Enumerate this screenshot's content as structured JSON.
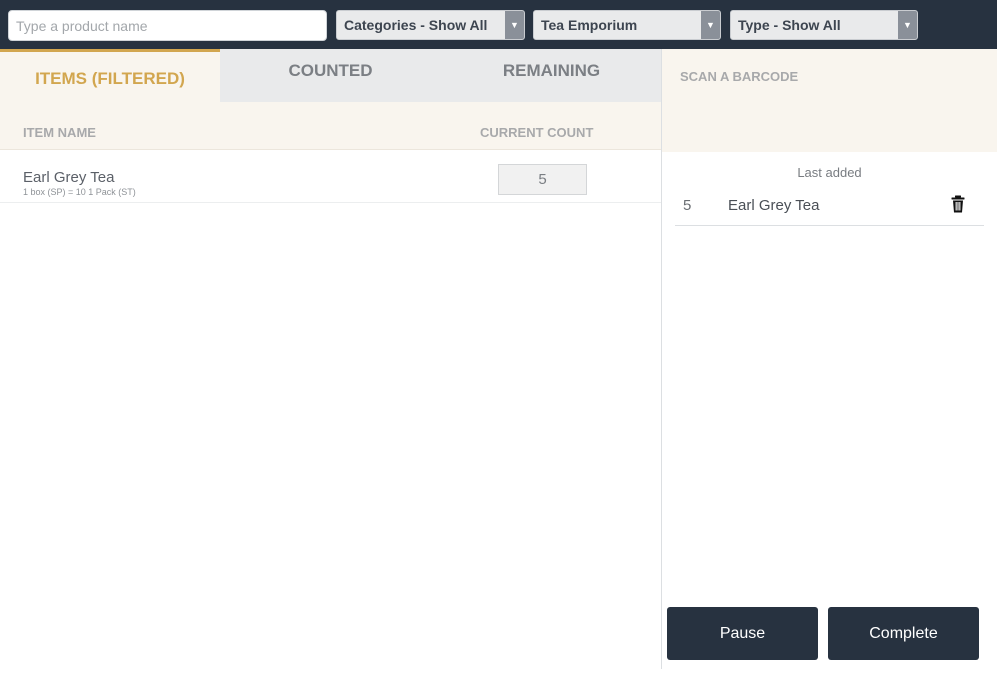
{
  "toolbar": {
    "search_placeholder": "Type a product name",
    "category_select": "Categories - Show All",
    "store_select": "Tea Emporium",
    "type_select": "Type - Show All"
  },
  "tabs": [
    {
      "label": "ITEMS (FILTERED)",
      "active": true
    },
    {
      "label": "COUNTED",
      "active": false
    },
    {
      "label": "REMAINING",
      "active": false
    }
  ],
  "table": {
    "headers": {
      "name": "ITEM NAME",
      "count": "CURRENT COUNT"
    },
    "rows": [
      {
        "name": "Earl Grey Tea",
        "detail": "1 box (SP) = 10 1 Pack (ST)",
        "count": "5"
      }
    ]
  },
  "scan_panel": {
    "title": "SCAN A BARCODE",
    "last_added_label": "Last added",
    "entries": [
      {
        "qty": "5",
        "name": "Earl Grey Tea",
        "icon": "trash-icon"
      }
    ]
  },
  "actions": {
    "pause": "Pause",
    "complete": "Complete"
  },
  "colors": {
    "header_bg": "#273240",
    "accent": "#d2a64f",
    "panel_bg": "#f9f5ee"
  }
}
